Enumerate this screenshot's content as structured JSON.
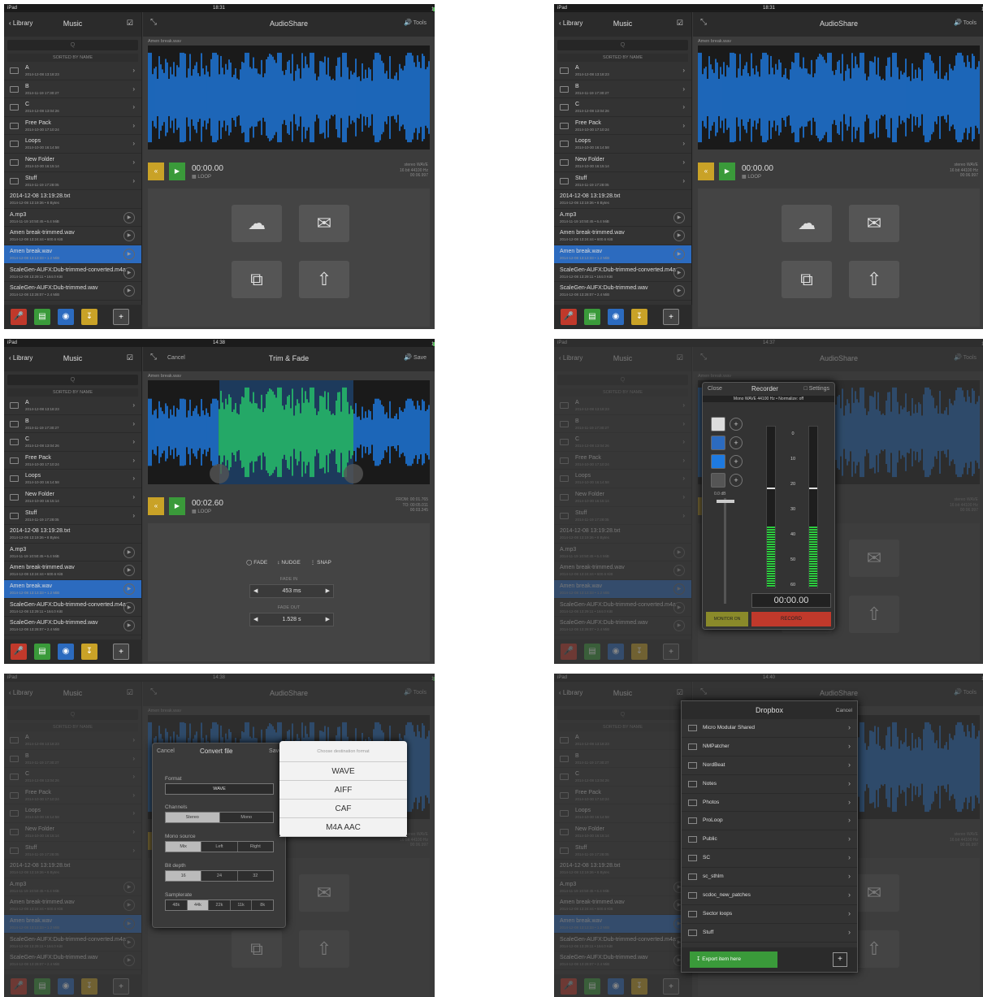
{
  "status": {
    "carrier": "iPad",
    "battery": "100%"
  },
  "times": [
    "18:31",
    "18:31",
    "14:38",
    "14:37",
    "14:38",
    "14:40"
  ],
  "sidebar": {
    "back": "Library",
    "title": "Music",
    "search_placeholder": "Q",
    "sorted": "SORTED BY NAME",
    "folders": [
      {
        "name": "A",
        "date": "2014-12-08 13:18:23"
      },
      {
        "name": "B",
        "date": "2014-11-19 17:30:27"
      },
      {
        "name": "C",
        "date": "2014-12-08 13:04:26"
      },
      {
        "name": "Free Pack",
        "date": "2014-10-30 17:10:24"
      },
      {
        "name": "Loops",
        "date": "2014-10-30 16:14:58"
      },
      {
        "name": "New Folder",
        "date": "2014-10-30 16:15:14"
      },
      {
        "name": "Stuff",
        "date": "2014-11-19 17:28:05"
      }
    ],
    "files": [
      {
        "name": "2014-12-08 13:19:28.txt",
        "date": "2014-12-08 13:19:36 • 8 Bytes"
      },
      {
        "name": "A.mp3",
        "date": "2014-11-19 10:50:45 • 6.4 MiB"
      },
      {
        "name": "Amen break-trimmed.wav",
        "date": "2014-12-08 13:24:44 • 600.6 KiB"
      },
      {
        "name": "Amen break.wav",
        "date": "2014-12-08 13:13:33 • 1.2 MiB"
      },
      {
        "name": "ScaleGen-AUFX:Dub-trimmed-converted.m4a",
        "date": "2014-12-08 13:29:11 • 164.0 KiB"
      },
      {
        "name": "ScaleGen-AUFX:Dub-trimmed.wav",
        "date": "2014-12-08 13:28:07 • 2.4 MiB"
      }
    ]
  },
  "main": {
    "title": "AudioShare",
    "tools": "Tools",
    "file": "Amen break.wav",
    "time": "00:00.00",
    "loop": "LOOP",
    "meta": [
      "stereo WAVE",
      "16 bit 44100 Hz",
      "00:06.997"
    ]
  },
  "trim": {
    "title": "Trim & Fade",
    "cancel": "Cancel",
    "save": "Save",
    "time": "00:02.60",
    "meta": [
      "FROM: 00:01.765",
      "TO: 00:05.011",
      "00:03.245"
    ],
    "modes": [
      "FADE",
      "NUDGE",
      "SNAP"
    ],
    "fade_in_label": "FADE IN",
    "fade_in": "453 ms",
    "fade_out_label": "FADE OUT",
    "fade_out": "1.528 s"
  },
  "recorder": {
    "close": "Close",
    "title": "Recorder",
    "settings": "Settings",
    "info": "Mono WAVE 44100 Hz • Normalize: off",
    "gain": "0.0 dB",
    "scale": [
      "0",
      "10",
      "20",
      "30",
      "40",
      "50",
      "60"
    ],
    "time": "00:00.00",
    "monitor": "MONITOR ON",
    "record": "RECORD"
  },
  "convert": {
    "cancel": "Cancel",
    "title": "Convert file",
    "save": "Save",
    "format_label": "Format",
    "format": "WAVE",
    "channels_label": "Channels",
    "channels": [
      "Stereo",
      "Mono"
    ],
    "mono_label": "Mono source",
    "mono": [
      "Mix",
      "Left",
      "Right"
    ],
    "bit_label": "Bit depth",
    "bits": [
      "16",
      "24",
      "32"
    ],
    "rate_label": "Samplerate",
    "rates": [
      "48k",
      "44k",
      "22k",
      "11k",
      "8k"
    ],
    "popover_title": "Choose destination format",
    "formats": [
      "WAVE",
      "AIFF",
      "CAF",
      "M4A AAC"
    ]
  },
  "dropbox": {
    "title": "Dropbox",
    "cancel": "Cancel",
    "items": [
      "Micro Modular Shared",
      "NMPatcher",
      "NordBeat",
      "Notes",
      "Photos",
      "ProLoop",
      "Public",
      "SC",
      "sc_sthlm",
      "scdoc_new_patches",
      "Sector loops",
      "Stuff"
    ],
    "export": "Export item here"
  },
  "colors": {
    "wave_blue": "#1e7ae0",
    "wave_green": "#26c46a",
    "accent_red": "#c0392b",
    "accent_yellow": "#c9a227",
    "accent_green": "#3a9a3a",
    "selected_row": "#2c6bbf"
  }
}
